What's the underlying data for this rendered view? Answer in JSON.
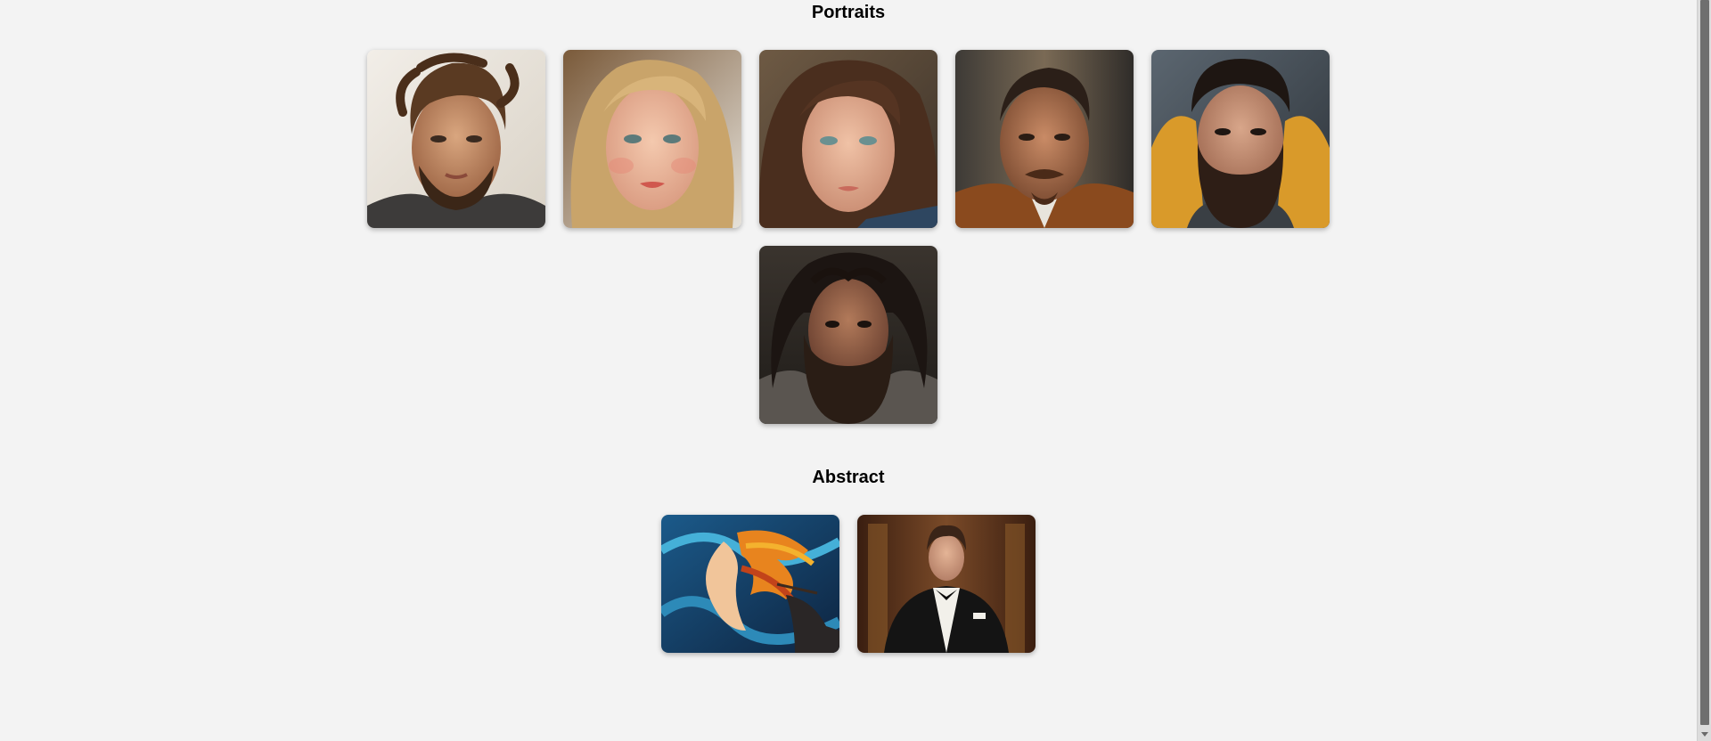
{
  "sections": [
    {
      "title": "Portraits"
    },
    {
      "title": "Abstract"
    }
  ],
  "colors": {
    "background": "#f3f3f3",
    "scrollbar_track": "#dcdcdc",
    "scrollbar_thumb": "#6f6f6f"
  }
}
